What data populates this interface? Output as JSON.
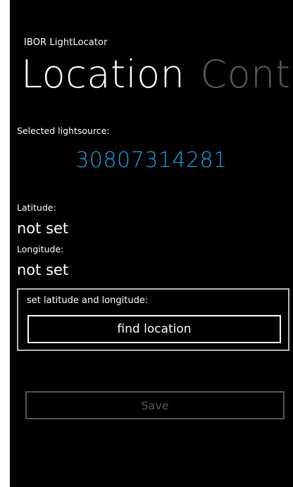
{
  "app": {
    "title": "IBOR LightLocator"
  },
  "pivot": {
    "active": "Location",
    "inactive": "Contr"
  },
  "selected_lightsource": {
    "label": "Selected lightsource:",
    "value": "30807314281"
  },
  "latitude": {
    "label": "Latitude:",
    "value": "not set"
  },
  "longitude": {
    "label": "Longitude:",
    "value": "not set"
  },
  "set_location": {
    "label": "set latitude and longitude:",
    "button_label": "find location"
  },
  "save": {
    "label": "Save",
    "enabled": false
  },
  "colors": {
    "background": "#000000",
    "foreground": "#ffffff",
    "accent": "#1ba1e2",
    "disabled": "#5a5a5a"
  }
}
